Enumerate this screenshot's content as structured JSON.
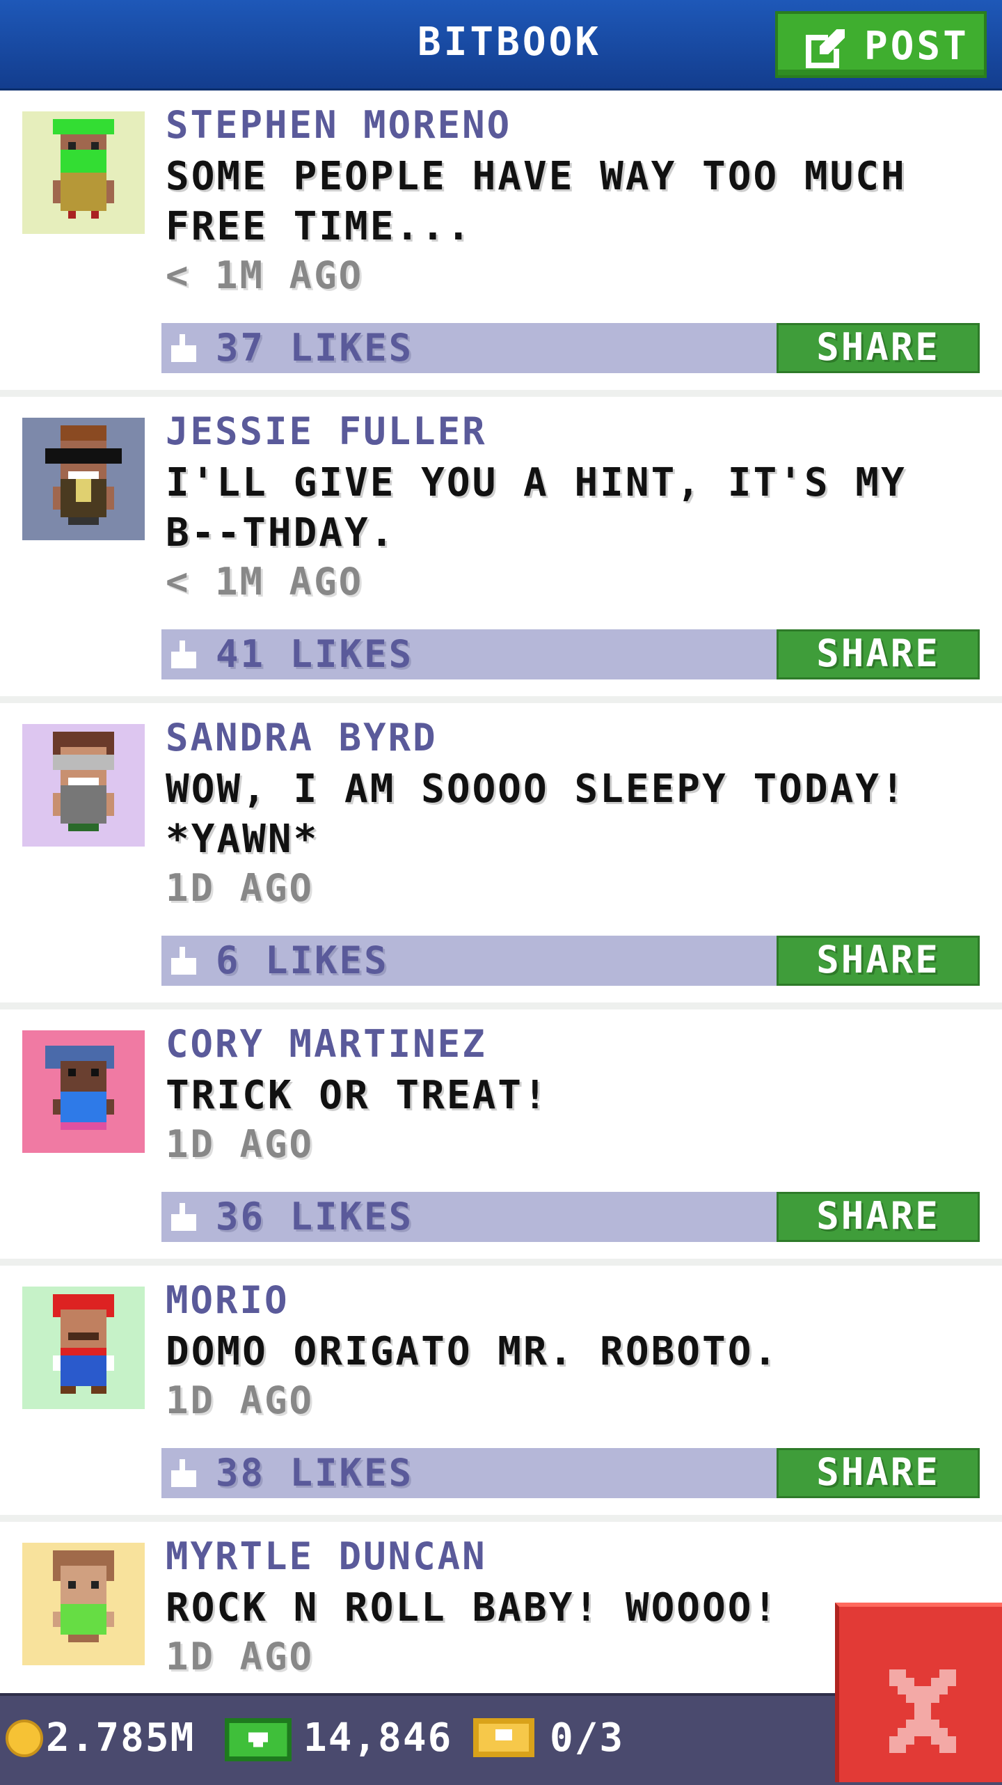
{
  "app": {
    "title": "BITBOOK",
    "post_label": "POST"
  },
  "posts": [
    {
      "name": "STEPHEN MORENO",
      "message": "SOME PEOPLE HAVE WAY TOO MUCH FREE TIME...",
      "time": "< 1M AGO",
      "likes": "37 LIKES",
      "share_label": "SHARE",
      "avatar_bg": "#e6eebc"
    },
    {
      "name": "JESSIE FULLER",
      "message": "I'LL GIVE YOU A HINT, IT'S MY B--THDAY.",
      "time": "< 1M AGO",
      "likes": "41 LIKES",
      "share_label": "SHARE",
      "avatar_bg": "#7d89aa"
    },
    {
      "name": "SANDRA BYRD",
      "message": "WOW, I AM SOOOO SLEEPY TODAY! *YAWN*",
      "time": "1D AGO",
      "likes": "6 LIKES",
      "share_label": "SHARE",
      "avatar_bg": "#ddc6f0"
    },
    {
      "name": "CORY MARTINEZ",
      "message": "TRICK OR TREAT!",
      "time": "1D AGO",
      "likes": "36 LIKES",
      "share_label": "SHARE",
      "avatar_bg": "#f07aa3"
    },
    {
      "name": "MORIO",
      "message": "DOMO ORIGATO MR. ROBOTO.",
      "time": "1D AGO",
      "likes": "38 LIKES",
      "share_label": "SHARE",
      "avatar_bg": "#c6f2c8"
    },
    {
      "name": "MYRTLE DUNCAN",
      "message": "ROCK N ROLL BABY! WOOOO!",
      "time": "1D AGO",
      "avatar_bg": "#f8e29c"
    }
  ],
  "status": {
    "coins": "2.785M",
    "bux": "14,846",
    "tickets": "0/3"
  },
  "colors": {
    "header": "#1e58b8",
    "accent_green": "#3f9d3a",
    "like_bar": "#b5b7d8",
    "close_red": "#e23a36"
  },
  "icons": [
    "post-edit-icon",
    "like-thumb-icon",
    "coin-icon",
    "bux-icon",
    "ticket-icon",
    "close-icon"
  ]
}
